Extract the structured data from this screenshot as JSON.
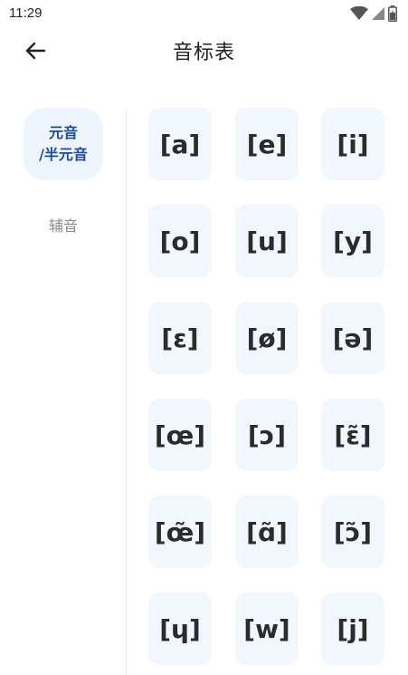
{
  "status_bar": {
    "time": "11:29",
    "icons": [
      "wifi-icon",
      "signal-icon",
      "battery-icon"
    ]
  },
  "app_bar": {
    "back_icon": "back-arrow-icon",
    "title": "音标表"
  },
  "sidebar": {
    "tabs": [
      {
        "label_line1": "元音",
        "label_line2": "/半元音",
        "active": true
      },
      {
        "label": "辅音",
        "active": false
      }
    ],
    "active_color": "#1d4d96",
    "active_background": "#eef4fc",
    "inactive_color": "#8a8a8a"
  },
  "symbols": [
    "[a]",
    "[e]",
    "[i]",
    "[o]",
    "[u]",
    "[y]",
    "[ɛ]",
    "[ø]",
    "[ə]",
    "[œ]",
    "[ɔ]",
    "[ɛ̃]",
    "[œ̃]",
    "[ɑ̃]",
    "[ɔ̃]",
    "[ɥ]",
    "[w]",
    "[j]"
  ],
  "colors": {
    "cell_background": "#f2f6fd",
    "symbol_text": "#2b2b2b"
  }
}
